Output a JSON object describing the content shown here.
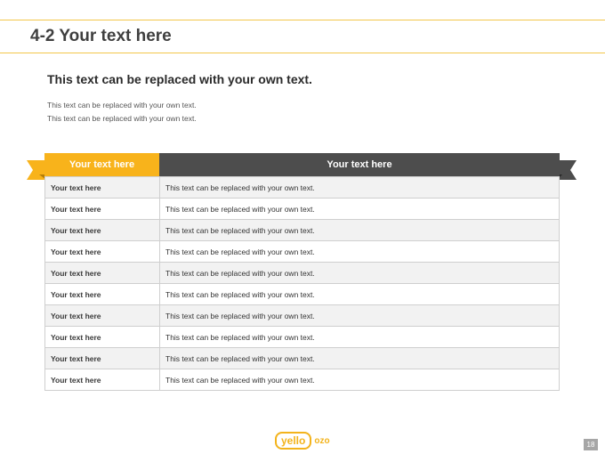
{
  "header": {
    "title": "4-2 Your text here"
  },
  "intro": {
    "subtitle": "This text can be replaced with your own text.",
    "lines": [
      "This text can be replaced with your own text.",
      "This text can be replaced with your own text."
    ]
  },
  "table": {
    "headers": [
      "Your text here",
      "Your text here"
    ],
    "rows": [
      [
        "Your text here",
        "This text can be replaced with your own text."
      ],
      [
        "Your text here",
        "This text can be replaced with your own text."
      ],
      [
        "Your text here",
        "This text can be replaced with your own text."
      ],
      [
        "Your text here",
        "This text can be replaced with your own text."
      ],
      [
        "Your text here",
        "This text can be replaced with your own text."
      ],
      [
        "Your text here",
        "This text can be replaced with your own text."
      ],
      [
        "Your text here",
        "This text can be replaced with your own text."
      ],
      [
        "Your text here",
        "This text can be replaced with your own text."
      ],
      [
        "Your text here",
        "This text can be replaced with your own text."
      ],
      [
        "Your text here",
        "This text can be replaced with your own text."
      ]
    ]
  },
  "footer": {
    "logo_main": "yello",
    "logo_tail": "ozo",
    "page_number": "18"
  },
  "colors": {
    "accent_yellow": "#f8b31b",
    "header_dark": "#4d4d4d",
    "rule": "#f3c74a"
  }
}
